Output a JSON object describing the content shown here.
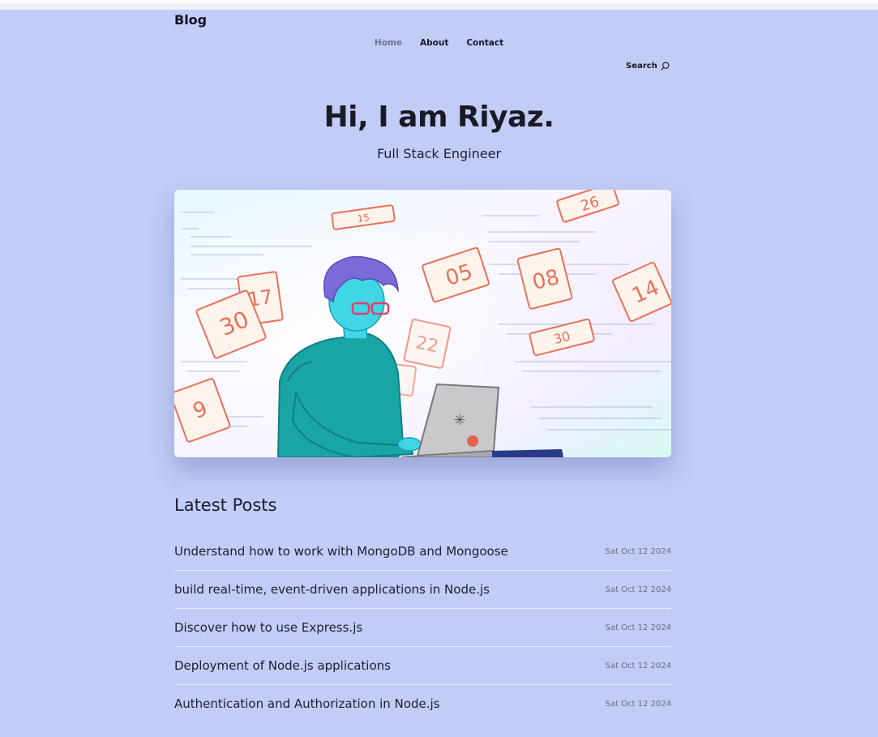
{
  "header": {
    "brand": "Blog",
    "nav": [
      {
        "label": "Home",
        "active": true
      },
      {
        "label": "About",
        "active": false
      },
      {
        "label": "Contact",
        "active": false
      }
    ],
    "search_label": "Search",
    "search_icon": "search-icon"
  },
  "hero": {
    "title": "Hi, I am Riyaz.",
    "subtitle": "Full Stack Engineer",
    "image_name": "developer-illustration"
  },
  "latest": {
    "title": "Latest Posts",
    "posts": [
      {
        "title": "Understand how to work with MongoDB and Mongoose",
        "date": "Sat Oct 12 2024"
      },
      {
        "title": "build real-time, event-driven applications in Node.js",
        "date": "Sat Oct 12 2024"
      },
      {
        "title": "Discover how to use Express.js",
        "date": "Sat Oct 12 2024"
      },
      {
        "title": "Deployment of Node.js applications",
        "date": "Sat Oct 12 2024"
      },
      {
        "title": "Authentication and Authorization in Node.js",
        "date": "Sat Oct 12 2024"
      }
    ]
  },
  "colors": {
    "page_background": "#c1cdf7",
    "active_nav": "#6f7290",
    "text": "#1c1c2e"
  }
}
